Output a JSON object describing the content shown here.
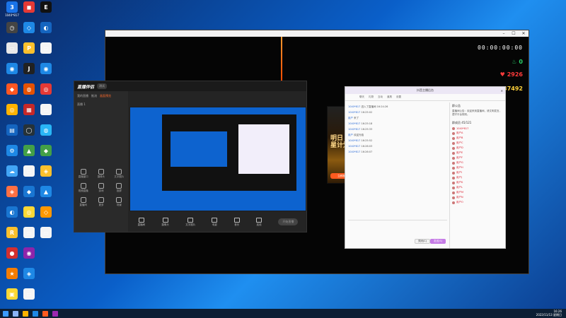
{
  "desktop_icons": [
    {
      "label": "1040*817",
      "color": "#1a73e8",
      "glyph": "3"
    },
    {
      "label": "",
      "color": "#444",
      "glyph": "◷"
    },
    {
      "label": "",
      "color": "#e8e8e8",
      "glyph": "▭"
    },
    {
      "label": "",
      "color": "#1e88e5",
      "glyph": "◉"
    },
    {
      "label": "",
      "color": "#ff5722",
      "glyph": "◆"
    },
    {
      "label": "",
      "color": "#ffb300",
      "glyph": "◎"
    },
    {
      "label": "",
      "color": "#1565c0",
      "glyph": "▤"
    },
    {
      "label": "",
      "color": "#1e88e5",
      "glyph": "⚙"
    },
    {
      "label": "",
      "color": "#42a5f5",
      "glyph": "☁"
    },
    {
      "label": "",
      "color": "#ff7043",
      "glyph": "◈"
    },
    {
      "label": "",
      "color": "#1976d2",
      "glyph": "◐"
    },
    {
      "label": "",
      "color": "#fbc02d",
      "glyph": "R"
    },
    {
      "label": "",
      "color": "#d32f2f",
      "glyph": "●"
    },
    {
      "label": "",
      "color": "#f57c00",
      "glyph": "★"
    },
    {
      "label": "",
      "color": "#fdd835",
      "glyph": "▣"
    },
    {
      "label": "",
      "color": "#e53935",
      "glyph": "◼"
    },
    {
      "label": "",
      "color": "#1e88e5",
      "glyph": "◇"
    },
    {
      "label": "",
      "color": "#fbc02d",
      "glyph": "P"
    },
    {
      "label": "",
      "color": "#212121",
      "glyph": "J"
    },
    {
      "label": "",
      "color": "#e65100",
      "glyph": "◍"
    },
    {
      "label": "",
      "color": "#c62828",
      "glyph": "▦"
    },
    {
      "label": "",
      "color": "#263238",
      "glyph": "◯"
    },
    {
      "label": "",
      "color": "#43a047",
      "glyph": "▲"
    },
    {
      "label": "",
      "color": "#f5f5f5",
      "glyph": "▭"
    },
    {
      "label": "",
      "color": "#1976d2",
      "glyph": "◆"
    },
    {
      "label": "",
      "color": "#fdd835",
      "glyph": "◎"
    },
    {
      "label": "",
      "color": "#f5f5f5",
      "glyph": "▭"
    },
    {
      "label": "",
      "color": "#8e24aa",
      "glyph": "◉"
    },
    {
      "label": "",
      "color": "#1e88e5",
      "glyph": "◈"
    },
    {
      "label": "",
      "color": "#f5f5f5",
      "glyph": "▭"
    },
    {
      "label": "",
      "color": "#111",
      "glyph": "E"
    },
    {
      "label": "",
      "color": "#1565c0",
      "glyph": "◐"
    },
    {
      "label": "",
      "color": "#f5f5f5",
      "glyph": "▭"
    },
    {
      "label": "",
      "color": "#1e88e5",
      "glyph": "◉"
    },
    {
      "label": "",
      "color": "#e53935",
      "glyph": "◎"
    },
    {
      "label": "",
      "color": "#f5f5f5",
      "glyph": "▭"
    },
    {
      "label": "",
      "color": "#29b6f6",
      "glyph": "◍"
    },
    {
      "label": "",
      "color": "#43a047",
      "glyph": "◆"
    },
    {
      "label": "",
      "color": "#fbc02d",
      "glyph": "◈"
    },
    {
      "label": "",
      "color": "#1e88e5",
      "glyph": "▲"
    },
    {
      "label": "",
      "color": "#ff9800",
      "glyph": "◇"
    },
    {
      "label": "",
      "color": "#f5f5f5",
      "glyph": "▭"
    }
  ],
  "broadcast": {
    "timer": "00:00:00:00",
    "stats": [
      {
        "icon": "fire-icon",
        "symbol": "♨",
        "value": "0",
        "color": "#2ad06a"
      },
      {
        "icon": "heart-icon",
        "symbol": "♥",
        "value": "2926",
        "color": "#ff3b3b"
      },
      {
        "icon": "star-icon",
        "symbol": "✦",
        "value": "37492",
        "color": "#ffd23a"
      }
    ]
  },
  "app": {
    "logo": "直播伴侣",
    "version_pill": "测试",
    "side_tabs": [
      "我的直播",
      "推流",
      "画面预览"
    ],
    "scene_label": "直播 1",
    "side_tools": [
      "直播窗口",
      "摄像头",
      "文字图片",
      "视频直播",
      "游戏",
      "投屏",
      "直播间",
      "更多",
      "场景"
    ],
    "bottom_tools": [
      "直播间",
      "摄像头",
      "文字图片",
      "电影",
      "音乐",
      "连线"
    ],
    "live_button": "开始直播"
  },
  "promo": {
    "title": "明日\n星计划",
    "button": "立即报名"
  },
  "chat": {
    "title": "抖音主播后台",
    "tabs": [
      "聊天",
      "礼物",
      "互动",
      "道具",
      "设置"
    ],
    "messages": [
      {
        "user": "1040*817",
        "text": "进入了直播间  16:24:26"
      },
      {
        "user": "1040*817",
        "text": "16:25:02"
      },
      {
        "user": "用户",
        "text": "来了"
      },
      {
        "user": "1040*817",
        "text": "16:25:18"
      },
      {
        "user": "1040*817",
        "text": "16:25:33"
      },
      {
        "user": "用户",
        "text": "欢迎光临"
      },
      {
        "user": "1040*817",
        "text": "16:25:52"
      },
      {
        "user": "1040*817",
        "text": "16:26:03"
      },
      {
        "user": "1040*817",
        "text": "16:26:07"
      }
    ],
    "notice_header": "群公告",
    "notice": "直播间公告：欢迎来到直播间，请文明发言，遵守平台规则。",
    "members_header": "群成员 45/121",
    "members": [
      "1040*817",
      "用户A",
      "用户B",
      "用户C",
      "用户D",
      "用户E",
      "用户F",
      "用户G",
      "用户H",
      "用户I",
      "用户J",
      "用户K",
      "用户L",
      "用户M",
      "用户N",
      "用户O"
    ],
    "close_label": "关闭(C)",
    "send_label": "发送(S)"
  },
  "taskbar": {
    "time": "16:26",
    "date": "2022/11/13 星期日"
  }
}
